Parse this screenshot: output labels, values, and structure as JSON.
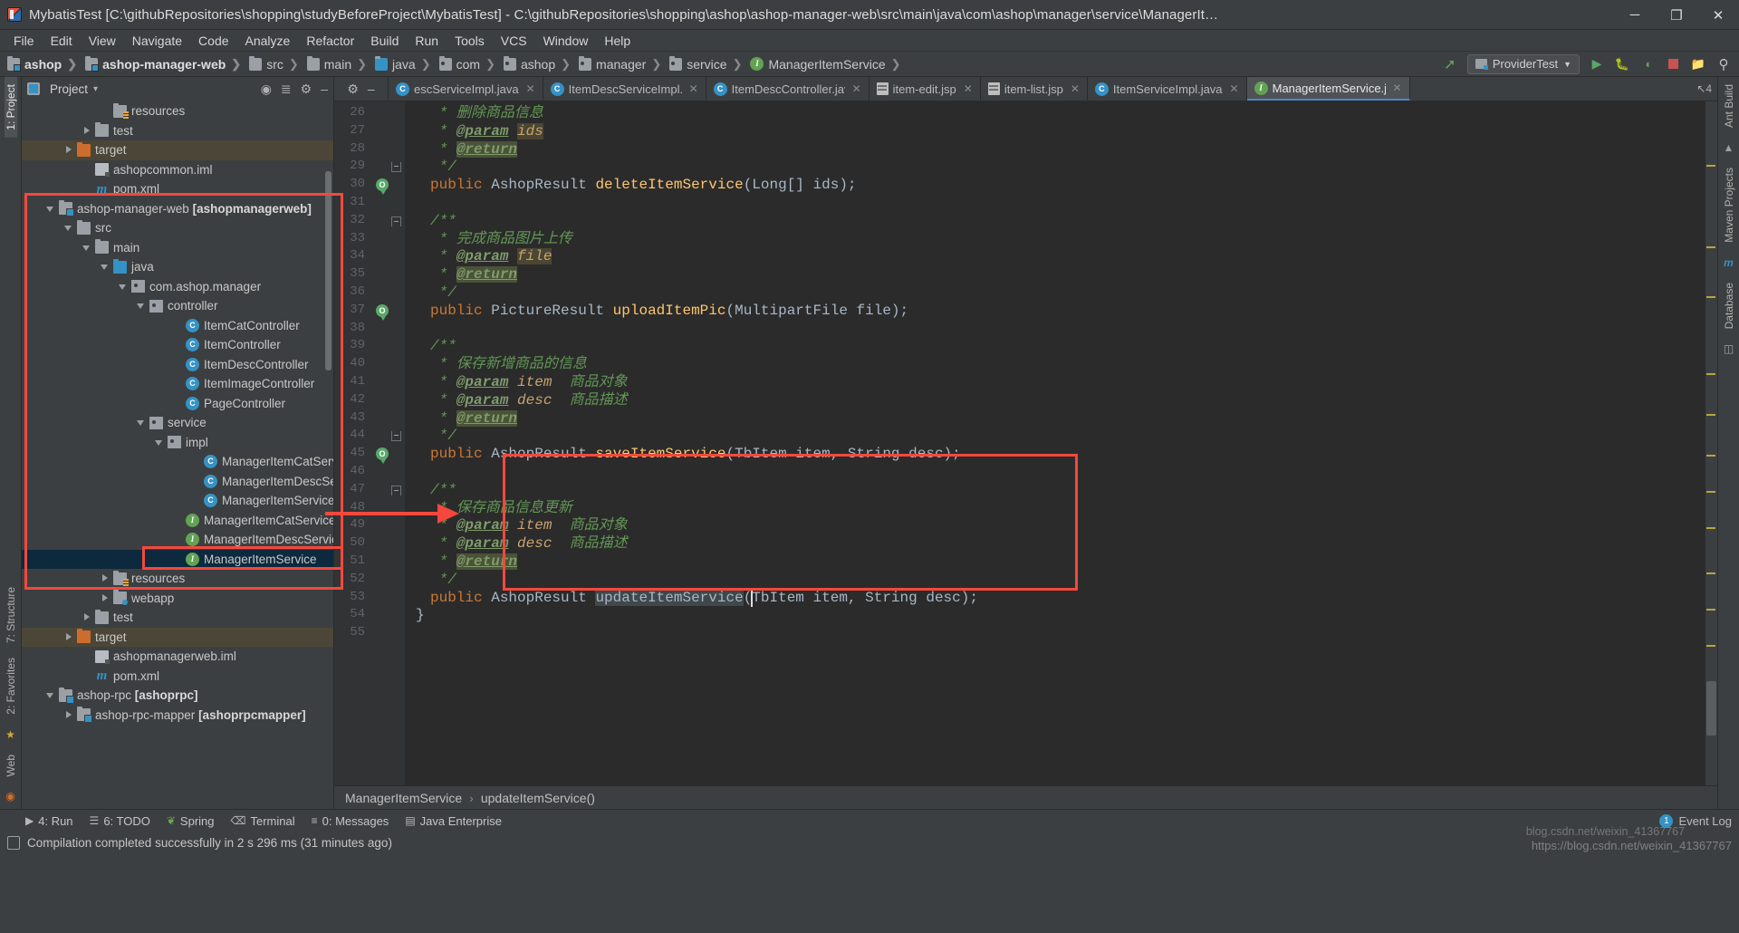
{
  "window": {
    "title": "MybatisTest [C:\\githubRepositories\\shopping\\studyBeforeProject\\MybatisTest] - C:\\githubRepositories\\shopping\\ashop\\ashop-manager-web\\src\\main\\java\\com\\ashop\\manager\\service\\ManagerItemService.java [ashopmanagerweb] ...",
    "minimize": "─",
    "maximize": "❐",
    "close": "✕"
  },
  "menubar": [
    "File",
    "Edit",
    "View",
    "Navigate",
    "Code",
    "Analyze",
    "Refactor",
    "Build",
    "Run",
    "Tools",
    "VCS",
    "Window",
    "Help"
  ],
  "navbar": {
    "crumbs": [
      {
        "label": "ashop",
        "icon": "module-folder-icon",
        "bold": true
      },
      {
        "label": "ashop-manager-web",
        "icon": "module-folder-icon",
        "bold": true
      },
      {
        "label": "src",
        "icon": "folder-icon",
        "bold": false
      },
      {
        "label": "main",
        "icon": "folder-icon",
        "bold": false
      },
      {
        "label": "java",
        "icon": "source-folder-icon",
        "bold": false
      },
      {
        "label": "com",
        "icon": "package-icon",
        "bold": false
      },
      {
        "label": "ashop",
        "icon": "package-icon",
        "bold": false
      },
      {
        "label": "manager",
        "icon": "package-icon",
        "bold": false
      },
      {
        "label": "service",
        "icon": "package-icon",
        "bold": false
      },
      {
        "label": "ManagerItemService",
        "icon": "interface-icon",
        "bold": false
      }
    ],
    "run_config": "ProviderTest",
    "run_config_caret": "▼"
  },
  "project_panel": {
    "title": "Project",
    "title_caret": "▾",
    "tree": [
      {
        "indent": 4,
        "arrow": "none",
        "icon": "resources-folder-icon",
        "label": "resources",
        "state": "normal"
      },
      {
        "indent": 3,
        "arrow": "collapsed",
        "icon": "folder-icon",
        "label": "test",
        "state": "normal"
      },
      {
        "indent": 2,
        "arrow": "collapsed",
        "icon": "target-folder-icon",
        "label": "target",
        "state": "target"
      },
      {
        "indent": 3,
        "arrow": "none",
        "icon": "iml-file-icon",
        "label": "ashopcommon.iml",
        "state": "normal"
      },
      {
        "indent": 3,
        "arrow": "none",
        "icon": "maven-file-icon",
        "label": "pom.xml",
        "state": "normal"
      },
      {
        "indent": 1,
        "arrow": "expanded",
        "icon": "module-folder-icon",
        "label": "ashop-manager-web ",
        "bold_suffix": "[ashopmanagerweb]",
        "state": "normal"
      },
      {
        "indent": 2,
        "arrow": "expanded",
        "icon": "folder-icon",
        "label": "src",
        "state": "normal"
      },
      {
        "indent": 3,
        "arrow": "expanded",
        "icon": "folder-icon",
        "label": "main",
        "state": "normal"
      },
      {
        "indent": 4,
        "arrow": "expanded",
        "icon": "source-folder-icon",
        "label": "java",
        "state": "normal"
      },
      {
        "indent": 5,
        "arrow": "expanded",
        "icon": "package-icon",
        "label": "com.ashop.manager",
        "state": "normal"
      },
      {
        "indent": 6,
        "arrow": "expanded",
        "icon": "package-icon",
        "label": "controller",
        "state": "normal"
      },
      {
        "indent": 8,
        "arrow": "none",
        "icon": "class-icon",
        "label": "ItemCatController",
        "state": "normal"
      },
      {
        "indent": 8,
        "arrow": "none",
        "icon": "class-icon",
        "label": "ItemController",
        "state": "normal"
      },
      {
        "indent": 8,
        "arrow": "none",
        "icon": "class-icon",
        "label": "ItemDescController",
        "state": "normal"
      },
      {
        "indent": 8,
        "arrow": "none",
        "icon": "class-icon",
        "label": "ItemImageController",
        "state": "normal"
      },
      {
        "indent": 8,
        "arrow": "none",
        "icon": "class-icon",
        "label": "PageController",
        "state": "normal"
      },
      {
        "indent": 6,
        "arrow": "expanded",
        "icon": "package-icon",
        "label": "service",
        "state": "normal"
      },
      {
        "indent": 7,
        "arrow": "expanded",
        "icon": "package-icon",
        "label": "impl",
        "state": "normal"
      },
      {
        "indent": 9,
        "arrow": "none",
        "icon": "class-icon",
        "label": "ManagerItemCatServiceIm",
        "state": "normal"
      },
      {
        "indent": 9,
        "arrow": "none",
        "icon": "class-icon",
        "label": "ManagerItemDescServiceI",
        "state": "normal"
      },
      {
        "indent": 9,
        "arrow": "none",
        "icon": "class-icon",
        "label": "ManagerItemServiceImpl",
        "state": "normal"
      },
      {
        "indent": 8,
        "arrow": "none",
        "icon": "interface-icon",
        "label": "ManagerItemCatService",
        "state": "normal"
      },
      {
        "indent": 8,
        "arrow": "none",
        "icon": "interface-icon",
        "label": "ManagerItemDescService",
        "state": "normal"
      },
      {
        "indent": 8,
        "arrow": "none",
        "icon": "interface-icon",
        "label": "ManagerItemService",
        "state": "selected"
      },
      {
        "indent": 4,
        "arrow": "collapsed",
        "icon": "resources-folder-icon",
        "label": "resources",
        "state": "normal"
      },
      {
        "indent": 4,
        "arrow": "collapsed",
        "icon": "web-folder-icon",
        "label": "webapp",
        "state": "normal"
      },
      {
        "indent": 3,
        "arrow": "collapsed",
        "icon": "folder-icon",
        "label": "test",
        "state": "normal"
      },
      {
        "indent": 2,
        "arrow": "collapsed",
        "icon": "target-folder-icon",
        "label": "target",
        "state": "target"
      },
      {
        "indent": 3,
        "arrow": "none",
        "icon": "iml-file-icon",
        "label": "ashopmanagerweb.iml",
        "state": "normal"
      },
      {
        "indent": 3,
        "arrow": "none",
        "icon": "maven-file-icon",
        "label": "pom.xml",
        "state": "normal"
      },
      {
        "indent": 1,
        "arrow": "expanded",
        "icon": "module-folder-icon",
        "label": "ashop-rpc ",
        "bold_suffix": "[ashoprpc]",
        "state": "normal"
      },
      {
        "indent": 2,
        "arrow": "collapsed",
        "icon": "module-folder-icon",
        "label": "ashop-rpc-mapper ",
        "bold_suffix": "[ashoprpcmapper]",
        "state": "normal"
      }
    ]
  },
  "left_strip": {
    "items": [
      "1: Project",
      "7: Structure",
      "2: Favorites"
    ],
    "bottom_label": "Web"
  },
  "right_strip": {
    "items": [
      "Ant Build",
      "Maven Projects",
      "Database"
    ]
  },
  "editor": {
    "tabs": [
      {
        "label": "escServiceImpl.java",
        "icon": "class-icon",
        "active": false,
        "truncated": true
      },
      {
        "label": "ItemDescServiceImpl.java",
        "icon": "class-icon",
        "active": false
      },
      {
        "label": "ItemDescController.java",
        "icon": "class-icon",
        "active": false
      },
      {
        "label": "item-edit.jsp",
        "icon": "jsp-file-icon",
        "active": false
      },
      {
        "label": "item-list.jsp",
        "icon": "jsp-file-icon",
        "active": false
      },
      {
        "label": "ItemServiceImpl.java",
        "icon": "class-icon",
        "active": false
      },
      {
        "label": "ManagerItemService.java",
        "icon": "interface-icon",
        "active": true
      }
    ],
    "tab_close": "✕",
    "tabbar_overflow": "↖4",
    "first_line_number": 26,
    "lines": [
      {
        "n": 26,
        "segs": [
          {
            "t": " * ",
            "c": "cmt"
          },
          {
            "t": "删除商品信息",
            "c": "cmt"
          }
        ]
      },
      {
        "n": 27,
        "segs": [
          {
            "t": " * ",
            "c": "cmt"
          },
          {
            "t": "@param",
            "c": "tag"
          },
          {
            "t": " ",
            "c": "cmt"
          },
          {
            "t": "ids",
            "c": "tagp hl-ids"
          }
        ]
      },
      {
        "n": 28,
        "segs": [
          {
            "t": " * ",
            "c": "cmt"
          },
          {
            "t": "@return",
            "c": "tag hl-ret"
          }
        ]
      },
      {
        "n": 29,
        "segs": [
          {
            "t": " */",
            "c": "cmt"
          }
        ]
      },
      {
        "n": 30,
        "segs": [
          {
            "t": "public",
            "c": "kw"
          },
          {
            "t": " ",
            "c": "pun"
          },
          {
            "t": "AshopResult",
            "c": "cls2"
          },
          {
            "t": " ",
            "c": "pun"
          },
          {
            "t": "deleteItemService",
            "c": "mth"
          },
          {
            "t": "(",
            "c": "pun"
          },
          {
            "t": "Long",
            "c": "cls2"
          },
          {
            "t": "[] ids);",
            "c": "pun"
          }
        ]
      },
      {
        "n": 31,
        "segs": []
      },
      {
        "n": 32,
        "segs": [
          {
            "t": "/**",
            "c": "cmt"
          }
        ]
      },
      {
        "n": 33,
        "segs": [
          {
            "t": " * ",
            "c": "cmt"
          },
          {
            "t": "完成商品图片上传",
            "c": "cmt"
          }
        ]
      },
      {
        "n": 34,
        "segs": [
          {
            "t": " * ",
            "c": "cmt"
          },
          {
            "t": "@param",
            "c": "tag"
          },
          {
            "t": " ",
            "c": "cmt"
          },
          {
            "t": "file",
            "c": "tagp hl-ids"
          }
        ]
      },
      {
        "n": 35,
        "segs": [
          {
            "t": " * ",
            "c": "cmt"
          },
          {
            "t": "@return",
            "c": "tag hl-ret"
          }
        ]
      },
      {
        "n": 36,
        "segs": [
          {
            "t": " */",
            "c": "cmt"
          }
        ]
      },
      {
        "n": 37,
        "segs": [
          {
            "t": "public",
            "c": "kw"
          },
          {
            "t": " ",
            "c": "pun"
          },
          {
            "t": "PictureResult",
            "c": "cls2"
          },
          {
            "t": " ",
            "c": "pun"
          },
          {
            "t": "uploadItemPic",
            "c": "mth"
          },
          {
            "t": "(",
            "c": "pun"
          },
          {
            "t": "MultipartFile",
            "c": "cls2"
          },
          {
            "t": " file);",
            "c": "pun"
          }
        ]
      },
      {
        "n": 38,
        "segs": []
      },
      {
        "n": 39,
        "segs": [
          {
            "t": "/**",
            "c": "cmt"
          }
        ]
      },
      {
        "n": 40,
        "segs": [
          {
            "t": " * ",
            "c": "cmt"
          },
          {
            "t": "保存新增商品的信息",
            "c": "cmt"
          }
        ]
      },
      {
        "n": 41,
        "segs": [
          {
            "t": " * ",
            "c": "cmt"
          },
          {
            "t": "@param",
            "c": "tag"
          },
          {
            "t": " ",
            "c": "cmt"
          },
          {
            "t": "item",
            "c": "tagp"
          },
          {
            "t": "  商品对象",
            "c": "cmt"
          }
        ]
      },
      {
        "n": 42,
        "segs": [
          {
            "t": " * ",
            "c": "cmt"
          },
          {
            "t": "@param",
            "c": "tag"
          },
          {
            "t": " ",
            "c": "cmt"
          },
          {
            "t": "desc",
            "c": "tagp"
          },
          {
            "t": "  商品描述",
            "c": "cmt"
          }
        ]
      },
      {
        "n": 43,
        "segs": [
          {
            "t": " * ",
            "c": "cmt"
          },
          {
            "t": "@return",
            "c": "tag hl-ret"
          }
        ]
      },
      {
        "n": 44,
        "segs": [
          {
            "t": " */",
            "c": "cmt"
          }
        ]
      },
      {
        "n": 45,
        "segs": [
          {
            "t": "public",
            "c": "kw"
          },
          {
            "t": " ",
            "c": "pun"
          },
          {
            "t": "AshopResult",
            "c": "cls2"
          },
          {
            "t": " ",
            "c": "pun"
          },
          {
            "t": "saveItemService",
            "c": "mth"
          },
          {
            "t": "(",
            "c": "pun"
          },
          {
            "t": "TbItem",
            "c": "cls2"
          },
          {
            "t": " item, ",
            "c": "pun"
          },
          {
            "t": "String",
            "c": "cls2"
          },
          {
            "t": " desc);",
            "c": "pun"
          }
        ]
      },
      {
        "n": 46,
        "segs": []
      },
      {
        "n": 47,
        "segs": [
          {
            "t": "/**",
            "c": "cmt"
          }
        ]
      },
      {
        "n": 48,
        "segs": [
          {
            "t": " * ",
            "c": "cmt"
          },
          {
            "t": "保存商品信息更新",
            "c": "cmt"
          }
        ]
      },
      {
        "n": 49,
        "segs": [
          {
            "t": " * ",
            "c": "cmt"
          },
          {
            "t": "@param",
            "c": "tag"
          },
          {
            "t": " ",
            "c": "cmt"
          },
          {
            "t": "item",
            "c": "tagp"
          },
          {
            "t": "  商品对象",
            "c": "cmt"
          }
        ]
      },
      {
        "n": 50,
        "segs": [
          {
            "t": " * ",
            "c": "cmt"
          },
          {
            "t": "@param",
            "c": "tag"
          },
          {
            "t": " ",
            "c": "cmt"
          },
          {
            "t": "desc",
            "c": "tagp"
          },
          {
            "t": "  商品描述",
            "c": "cmt"
          }
        ]
      },
      {
        "n": 51,
        "segs": [
          {
            "t": " * ",
            "c": "cmt"
          },
          {
            "t": "@return",
            "c": "tag hl-ret"
          }
        ]
      },
      {
        "n": 52,
        "segs": [
          {
            "t": " */",
            "c": "cmt"
          }
        ]
      },
      {
        "n": 53,
        "segs": [
          {
            "t": "public",
            "c": "kw"
          },
          {
            "t": " ",
            "c": "pun"
          },
          {
            "t": "AshopResult",
            "c": "cls2"
          },
          {
            "t": " ",
            "c": "pun"
          },
          {
            "t": "updateItemService",
            "c": "cls2 ident-hl"
          },
          {
            "t": "(",
            "c": "pun"
          },
          {
            "t": "TbItem",
            "c": "cls2"
          },
          {
            "t": " item, ",
            "c": "pun"
          },
          {
            "t": "String",
            "c": "cls2"
          },
          {
            "t": " desc);",
            "c": "pun"
          }
        ]
      },
      {
        "n": 54,
        "segs": [
          {
            "t": "}",
            "c": "pun"
          }
        ]
      },
      {
        "n": 55,
        "segs": []
      }
    ],
    "breadcrumb": {
      "file": "ManagerItemService",
      "sep": "›",
      "member": "updateItemService()"
    }
  },
  "bottombar": {
    "items": [
      {
        "label": "4: Run",
        "underline": "4",
        "icon": "run-icon"
      },
      {
        "label": "6: TODO",
        "underline": "6",
        "icon": "todo-icon"
      },
      {
        "label": "Spring",
        "underline": "",
        "icon": "spring-leaf-icon"
      },
      {
        "label": "Terminal",
        "underline": "",
        "icon": "terminal-icon"
      },
      {
        "label": "0: Messages",
        "underline": "0",
        "icon": "messages-icon"
      },
      {
        "label": "Java Enterprise",
        "underline": "",
        "icon": "java-ee-icon"
      }
    ],
    "event_log": "Event Log",
    "event_count": "1"
  },
  "statusbar": {
    "message": "Compilation completed successfully in 2 s 296 ms (31 minutes ago)",
    "watermark": "https://blog.csdn.net/weixin_41367767",
    "watermark2": "blog.csdn.net/weixin_41367767"
  },
  "colors": {
    "accent_red": "#f4483c",
    "editor_bg": "#2b2b2b",
    "panel_bg": "#3c3f41",
    "selection": "#0d293e",
    "comment_green": "#629755",
    "keyword_orange": "#cc7832",
    "method_yellow": "#ffc66d"
  }
}
